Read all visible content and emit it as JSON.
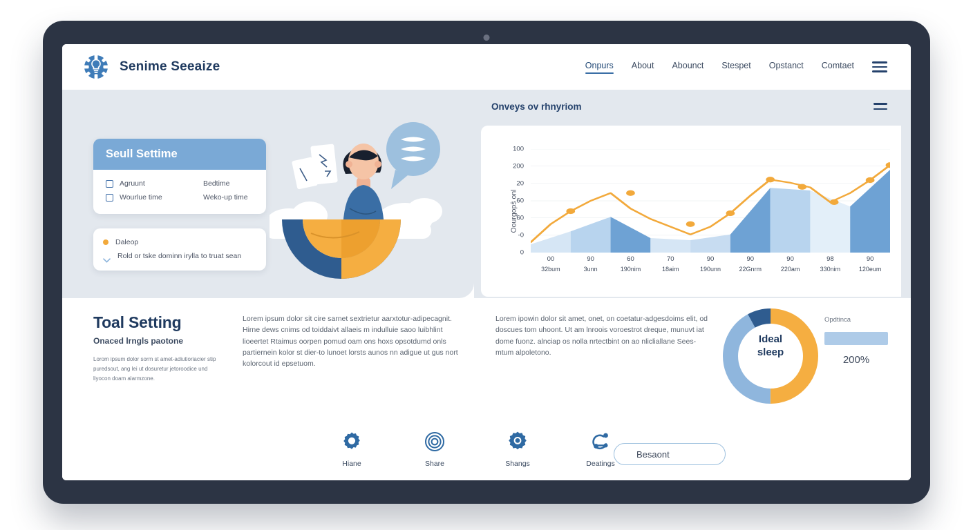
{
  "brand": {
    "name": "Senime Seeaize",
    "logo_icon": "gear-lightbulb-icon"
  },
  "nav": {
    "items": [
      {
        "label": "Onpurs",
        "active": true
      },
      {
        "label": "About",
        "active": false
      },
      {
        "label": "Abounct",
        "active": false
      },
      {
        "label": "Stespet",
        "active": false
      },
      {
        "label": "Opstanct",
        "active": false
      },
      {
        "label": "Comtaet",
        "active": false
      }
    ],
    "menu_icon": "hamburger-icon"
  },
  "subheader": {
    "title": "Onveys ov rhnyriom",
    "menu_icon": "menu-icon"
  },
  "settings_card": {
    "title": "Seull Settime",
    "rows": [
      {
        "label": "Agruunt",
        "value": "Bedtime"
      },
      {
        "label": "Wourlue time",
        "value": "Weko-up time"
      }
    ]
  },
  "legend_card": {
    "items": [
      {
        "icon": "dot-icon",
        "text": "Daleop"
      },
      {
        "icon": "chevron-down-icon",
        "text": "Rold or tske dominn irylla to truat sean"
      }
    ]
  },
  "chart_data": {
    "type": "area",
    "title": "Onveys ov rhnyriom",
    "xlabel": "",
    "ylabel": "Oourgopŝ onl",
    "ylim": [
      0,
      7
    ],
    "ytick_labels": [
      "100",
      "200",
      "20",
      "60",
      "60",
      "-0",
      "0"
    ],
    "categories": [
      "00",
      "90",
      "60",
      "70",
      "90",
      "90",
      "90",
      "98",
      "90"
    ],
    "category_sublabels": [
      "32bum",
      "3unn",
      "190nim",
      "18aim",
      "190unn",
      "22Gnrm",
      "220am",
      "330nim",
      "120eum"
    ],
    "series": [
      {
        "name": "bars",
        "type": "area",
        "values": [
          0.55,
          2.3,
          1.05,
          0.5,
          4.3,
          4.05,
          1.35,
          4.35,
          5.55
        ]
      },
      {
        "name": "line",
        "type": "line",
        "values": [
          1.55,
          2.65,
          1.7,
          1.3,
          2.55,
          5.15,
          4.7,
          3.05,
          4.1
        ]
      },
      {
        "name": "line-markers",
        "type": "scatter",
        "values": [
          1.85,
          2.65,
          1.7,
          2.55,
          5.15,
          4.7,
          3.05,
          5.6,
          6.25
        ]
      }
    ],
    "grid": true,
    "legend_position": "none",
    "colors": {
      "bar_light": "#d6e6f5",
      "bar_mid": "#b8d4ee",
      "bar_dark": "#6ea2d4",
      "line": "#f2a93b"
    }
  },
  "content": {
    "intro_title": "Toal Setting",
    "intro_subtitle": "Onaced lrngls paotone",
    "intro_body": "Lorom ipsum dolor sorm st amet-adiutioriacier stip puredsout, ang lei ut dosuretur jetoroodice und liyocon doam alarmzone.",
    "paragraph_1": "Lorem ipsum dolor sit cire sarnet sextrietur aarxtotur-adipecagnit. Hirne dews cnims  od toiddaivt allaeis m indulluie saoo luibhlint lioeertet Rtaimus oorpen pomud oam ons hoxs opsotdumd onls partiernein kolor st dier-to lunoet lorsts aunos nn adigue ut gus nort kolorcout id epsetuom.",
    "paragraph_2": "Lorem ipowin dolor sit amet, onet, on coetatur-adgesdoims elit, od doscues tom uhoont. Ut am lnroois voroestrot dreque, munuvt iat dome fuonz. alnciap os nolla nrtectbint on ao nlicliallane Sees-mtum alpoletono."
  },
  "donut": {
    "center_line1": "Ideal",
    "center_line2": "sleep",
    "segments": [
      {
        "name": "orange",
        "color": "#f5ae41",
        "percent": 50
      },
      {
        "name": "light-blue",
        "color": "#8fb6dd",
        "percent": 42
      },
      {
        "name": "dark-blue",
        "color": "#2f5c8f",
        "percent": 8
      }
    ],
    "legend_label": "Opdtinca",
    "percent_value": "200%"
  },
  "icons": [
    {
      "icon": "gear-icon",
      "label": "Hiane"
    },
    {
      "icon": "target-icon",
      "label": "Share"
    },
    {
      "icon": "gear-solid-icon",
      "label": "Shangs"
    },
    {
      "icon": "share-network-icon",
      "label": "Deatings"
    }
  ],
  "cta": {
    "label": "Besaont"
  }
}
